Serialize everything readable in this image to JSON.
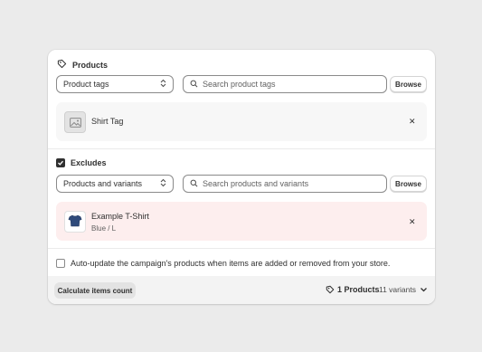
{
  "products_section": {
    "title": "Products",
    "type_select": "Product tags",
    "search_placeholder": "Search product tags",
    "browse_label": "Browse",
    "item_name": "Shirt Tag"
  },
  "excludes_section": {
    "title": "Excludes",
    "checked": true,
    "type_select": "Products and variants",
    "search_placeholder": "Search products and variants",
    "browse_label": "Browse",
    "item_name": "Example T-Shirt",
    "item_variant": "Blue / L"
  },
  "auto_update": {
    "label": "Auto-update the campaign's products when items are added or removed from your store.",
    "checked": false
  },
  "footer": {
    "calc_button": "Calculate items count",
    "products_count": "1 Products",
    "variants_count": "11 variants"
  },
  "colors": {
    "background": "#ebebeb",
    "card": "#ffffff",
    "exclude_item_bg": "#fdeeee",
    "product_item_bg": "#f7f7f7",
    "checkbox_checked": "#303030"
  }
}
